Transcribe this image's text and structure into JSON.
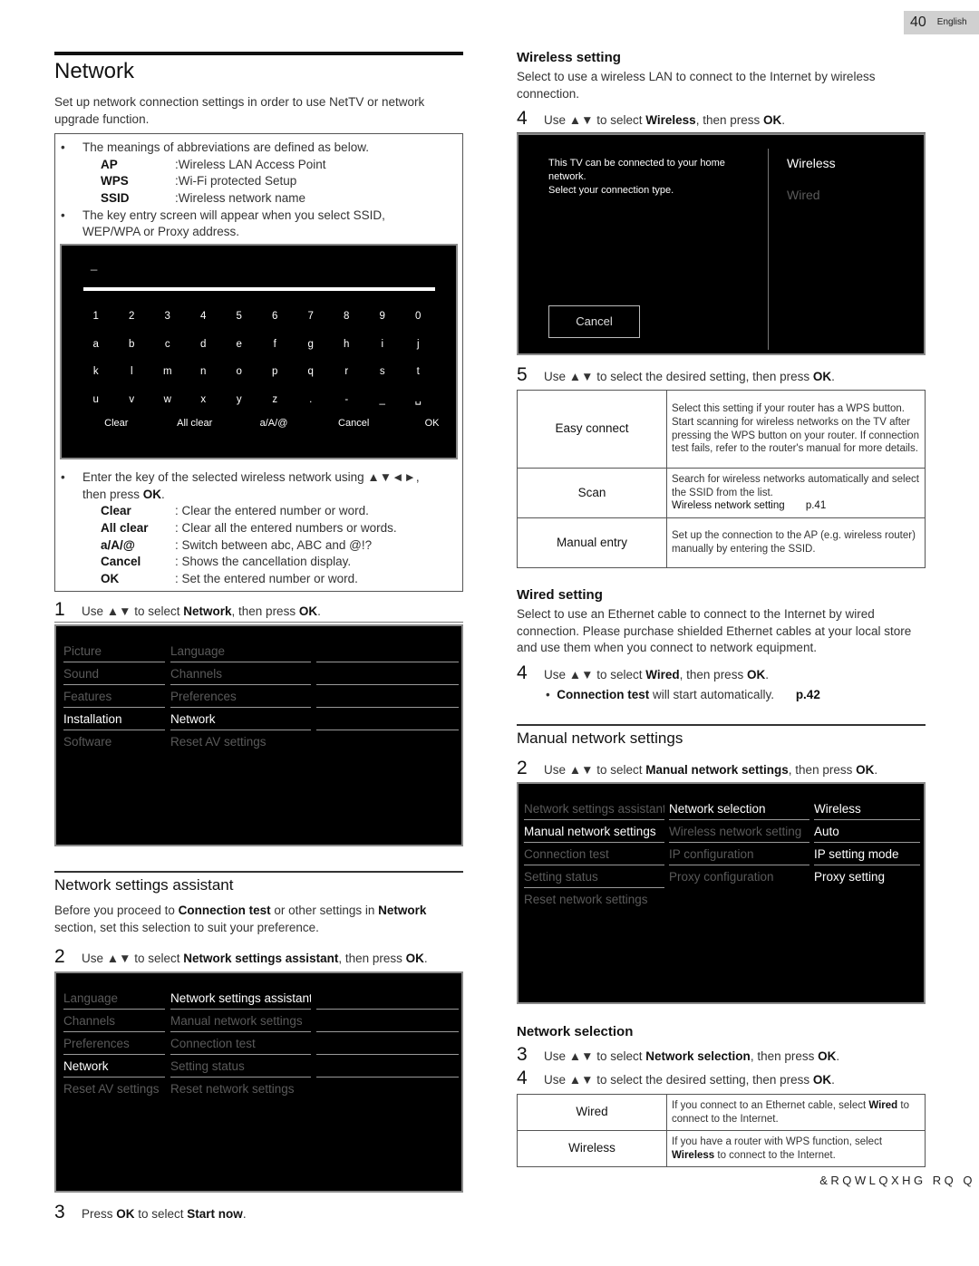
{
  "page": {
    "number": "40",
    "language": "English",
    "footer_code": "&RQWLQXHG RQ Q"
  },
  "network": {
    "title": "Network",
    "intro": "Set up network connection settings in order to use NetTV or network upgrade function.",
    "note_box": {
      "bullet1": "The meanings of abbreviations are defined as below.",
      "abbreviations": [
        {
          "key": "AP",
          "value": ":Wireless LAN Access Point"
        },
        {
          "key": "WPS",
          "value": ":Wi-Fi protected Setup"
        },
        {
          "key": "SSID",
          "value": ":Wireless network name"
        }
      ],
      "bullet2": "The key entry screen will appear when you select SSID, WEP/WPA or Proxy address.",
      "bullet3_pre": "Enter the key of the selected wireless network using ▲▼◄►,",
      "bullet3_line2_pre": "then press ",
      "bullet3_ok": "OK",
      "bullet3_end": ".",
      "key_functions": [
        {
          "key": "Clear",
          "value": ": Clear the entered number or word."
        },
        {
          "key": "All clear",
          "value": ": Clear all the entered numbers or words."
        },
        {
          "key": "a/A/@",
          "value": ": Switch between abc, ABC and @!?"
        },
        {
          "key": "Cancel",
          "value": ": Shows the cancellation display."
        },
        {
          "key": "OK",
          "value": ": Set the entered number or word."
        }
      ]
    },
    "keyboard": {
      "cursor": "_",
      "rows": [
        [
          "1",
          "2",
          "3",
          "4",
          "5",
          "6",
          "7",
          "8",
          "9",
          "0"
        ],
        [
          "a",
          "b",
          "c",
          "d",
          "e",
          "f",
          "g",
          "h",
          "i",
          "j"
        ],
        [
          "k",
          "l",
          "m",
          "n",
          "o",
          "p",
          "q",
          "r",
          "s",
          "t"
        ],
        [
          "u",
          "v",
          "w",
          "x",
          "y",
          "z",
          ".",
          "-",
          "_",
          "␣"
        ]
      ],
      "actions": [
        "Clear",
        "All clear",
        "a/A/@",
        "Cancel",
        "OK"
      ]
    },
    "step1": {
      "num": "1",
      "pre": "Use ▲▼ to select ",
      "bold": "Network",
      "mid": ", then press ",
      "ok": "OK",
      "end": "."
    },
    "menu1": {
      "col1": [
        {
          "label": "Picture",
          "state": "dim"
        },
        {
          "label": "Sound",
          "state": "dim"
        },
        {
          "label": "Features",
          "state": "dim"
        },
        {
          "label": "Installation",
          "state": "hi"
        },
        {
          "label": "Software",
          "state": "dim"
        }
      ],
      "col2": [
        {
          "label": "Language",
          "state": "dim"
        },
        {
          "label": "Channels",
          "state": "dim"
        },
        {
          "label": "Preferences",
          "state": "dim"
        },
        {
          "label": "Network",
          "state": "hi"
        },
        {
          "label": "Reset AV settings",
          "state": "dim"
        }
      ]
    }
  },
  "assistant": {
    "title": "Network settings assistant",
    "intro_pre": "Before you proceed to ",
    "intro_b1": "Connection test",
    "intro_mid": " or other settings in ",
    "intro_b2": "Network",
    "intro_end": " section, set this selection to suit your preference.",
    "step2": {
      "num": "2",
      "pre": "Use ▲▼ to select ",
      "bold": "Network settings assistant",
      "mid": ", then press ",
      "ok": "OK",
      "end": "."
    },
    "menu2": {
      "col1": [
        {
          "label": "Language",
          "state": "dim"
        },
        {
          "label": "Channels",
          "state": "dim"
        },
        {
          "label": "Preferences",
          "state": "dim"
        },
        {
          "label": "Network",
          "state": "hi"
        },
        {
          "label": "Reset AV settings",
          "state": "dim"
        }
      ],
      "col2": [
        {
          "label": "Network settings assistant",
          "state": "hi"
        },
        {
          "label": "Manual network settings",
          "state": "dim"
        },
        {
          "label": "Connection test",
          "state": "dim"
        },
        {
          "label": "Setting status",
          "state": "dim"
        },
        {
          "label": "Reset network settings",
          "state": "dim"
        }
      ]
    },
    "step3": {
      "num": "3",
      "pre": "Press ",
      "ok": "OK",
      "mid": " to select ",
      "bold": "Start now",
      "end": "."
    }
  },
  "wireless": {
    "title": "Wireless setting",
    "intro": "Select to use a wireless LAN to connect to the Internet by wireless connection.",
    "step4": {
      "num": "4",
      "pre": "Use ▲▼ to select ",
      "bold": "Wireless",
      "mid": ", then press ",
      "ok": "OK",
      "end": "."
    },
    "screen": {
      "message1": "This TV can be connected to your home network.",
      "message2": "Select your connection type.",
      "cancel": "Cancel",
      "options": [
        {
          "label": "Wireless",
          "state": "hi"
        },
        {
          "label": "Wired",
          "state": "dim"
        }
      ]
    },
    "step5": {
      "num": "5",
      "pre": "Use ▲▼ to select the desired setting, then press ",
      "ok": "OK",
      "end": "."
    },
    "table": [
      {
        "name": "Easy connect",
        "desc": "Select this setting if your router has a WPS button. Start scanning for wireless networks on the TV after pressing the WPS button on your router. If connection test fails, refer to the router's manual for more details."
      },
      {
        "name": "Scan",
        "desc": "Search for wireless networks automatically and select the SSID from the list.",
        "ref_label": "Wireless network setting",
        "ref_page": "p.41"
      },
      {
        "name": "Manual entry",
        "desc": "Set up the connection to the AP (e.g. wireless router) manually by entering the SSID."
      }
    ]
  },
  "wired": {
    "title": "Wired setting",
    "intro": "Select to use an Ethernet cable to connect to the Internet by wired connection. Please purchase shielded Ethernet cables at your local store and use them when you connect to network equipment.",
    "step4": {
      "num": "4",
      "pre": "Use ▲▼ to select ",
      "bold": "Wired",
      "mid": ", then press ",
      "ok": "OK",
      "end": "."
    },
    "note_bold": "Connection test",
    "note_text": " will start automatically.",
    "note_page": "p.42"
  },
  "manual": {
    "title": "Manual network settings",
    "step2": {
      "num": "2",
      "pre": "Use ▲▼ to select ",
      "bold": "Manual network settings",
      "mid": ", then press ",
      "ok": "OK",
      "end": "."
    },
    "menu3": {
      "col1": [
        {
          "label": "Network settings assistant",
          "state": "dim"
        },
        {
          "label": "Manual network settings",
          "state": "hi"
        },
        {
          "label": "Connection test",
          "state": "dim"
        },
        {
          "label": "Setting status",
          "state": "dim"
        },
        {
          "label": "Reset network settings",
          "state": "dim"
        }
      ],
      "col2": [
        {
          "label": "Network selection",
          "state": "hi"
        },
        {
          "label": "Wireless network setting",
          "state": "dim"
        },
        {
          "label": "IP configuration",
          "state": "dim"
        },
        {
          "label": "Proxy configuration",
          "state": "dim"
        }
      ],
      "col3": [
        {
          "label": "Wireless",
          "state": "hi"
        },
        {
          "label": "Auto",
          "state": "hi"
        },
        {
          "label": "IP setting mode",
          "state": "hi"
        },
        {
          "label": "Proxy setting",
          "state": "hi"
        }
      ]
    }
  },
  "selection": {
    "title": "Network selection",
    "step3": {
      "num": "3",
      "pre": "Use ▲▼ to select ",
      "bold": "Network selection",
      "mid": ", then press ",
      "ok": "OK",
      "end": "."
    },
    "step4": {
      "num": "4",
      "pre": "Use ▲▼ to select the desired setting, then press ",
      "ok": "OK",
      "end": "."
    },
    "table": [
      {
        "name": "Wired",
        "desc_pre": "If you connect to an Ethernet cable, select ",
        "desc_bold": "Wired",
        "desc_end": " to connect to the Internet."
      },
      {
        "name": "Wireless",
        "desc_pre": "If you have a router with WPS function, select ",
        "desc_bold": "Wireless",
        "desc_end": " to connect to the Internet."
      }
    ]
  }
}
